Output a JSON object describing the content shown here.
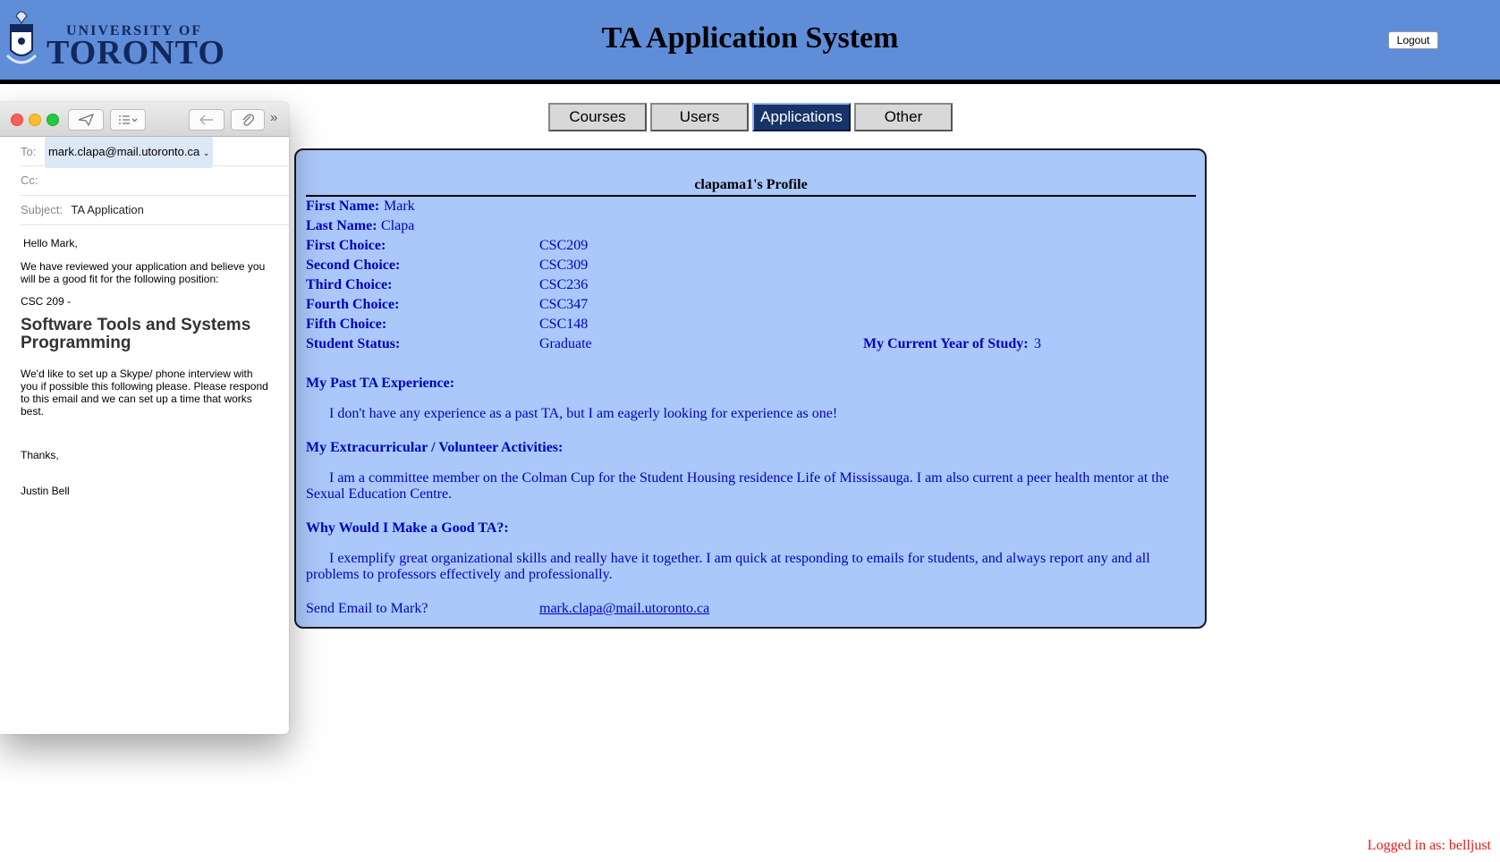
{
  "header": {
    "logo_line1": "UNIVERSITY OF",
    "logo_line2": "TORONTO",
    "title": "TA Application System",
    "logout_label": "Logout"
  },
  "tabs": [
    {
      "label": "Courses",
      "active": false
    },
    {
      "label": "Users",
      "active": false
    },
    {
      "label": "Applications",
      "active": true
    },
    {
      "label": "Other",
      "active": false
    }
  ],
  "profile": {
    "title": "clapama1's Profile",
    "first_name_label": "First Name:",
    "first_name": "Mark",
    "last_name_label": "Last Name:",
    "last_name": "Clapa",
    "choices": [
      {
        "label": "First Choice:",
        "value": "CSC209"
      },
      {
        "label": "Second Choice:",
        "value": "CSC309"
      },
      {
        "label": "Third Choice:",
        "value": "CSC236"
      },
      {
        "label": "Fourth Choice:",
        "value": "CSC347"
      },
      {
        "label": "Fifth Choice:",
        "value": "CSC148"
      }
    ],
    "status_label": "Student Status:",
    "status": "Graduate",
    "year_label": "My Current Year of Study:",
    "year": "3",
    "past_ta_heading": "My Past TA Experience:",
    "past_ta_text": "I don't have any experience as a past TA, but I am eagerly looking for experience as one!",
    "extra_heading": "My Extracurricular / Volunteer Activities:",
    "extra_text": "I am a committee member on the Colman Cup for the Student Housing residence Life of Mississauga. I am also current a peer health mentor at the Sexual Education Centre.",
    "why_heading": "Why Would I Make a Good TA?:",
    "why_text": "I exemplify great organizational skills and really have it together. I am quick at responding to emails for students, and always report any and all problems to professors effectively and professionally.",
    "email_label": "Send Email to Mark?",
    "email": "mark.clapa@mail.utoronto.ca"
  },
  "mail": {
    "to_label": "To:",
    "to_value": "mark.clapa@mail.utoronto.ca",
    "cc_label": "Cc:",
    "subject_label": "Subject:",
    "subject_value": "TA Application",
    "greeting": "Hello Mark,",
    "para1": "We have reviewed your application and believe you will be a good fit for the following position:",
    "course_code": "CSC 209 -",
    "course_name": "Software Tools and Systems Programming",
    "para2": "We'd like to set up a Skype/ phone interview with you if possible this following please. Please respond to this email and we can set up a time that works best.",
    "thanks": "Thanks,",
    "signature": "Justin Bell"
  },
  "footer": {
    "logged_in": "Logged in as: belljust"
  }
}
